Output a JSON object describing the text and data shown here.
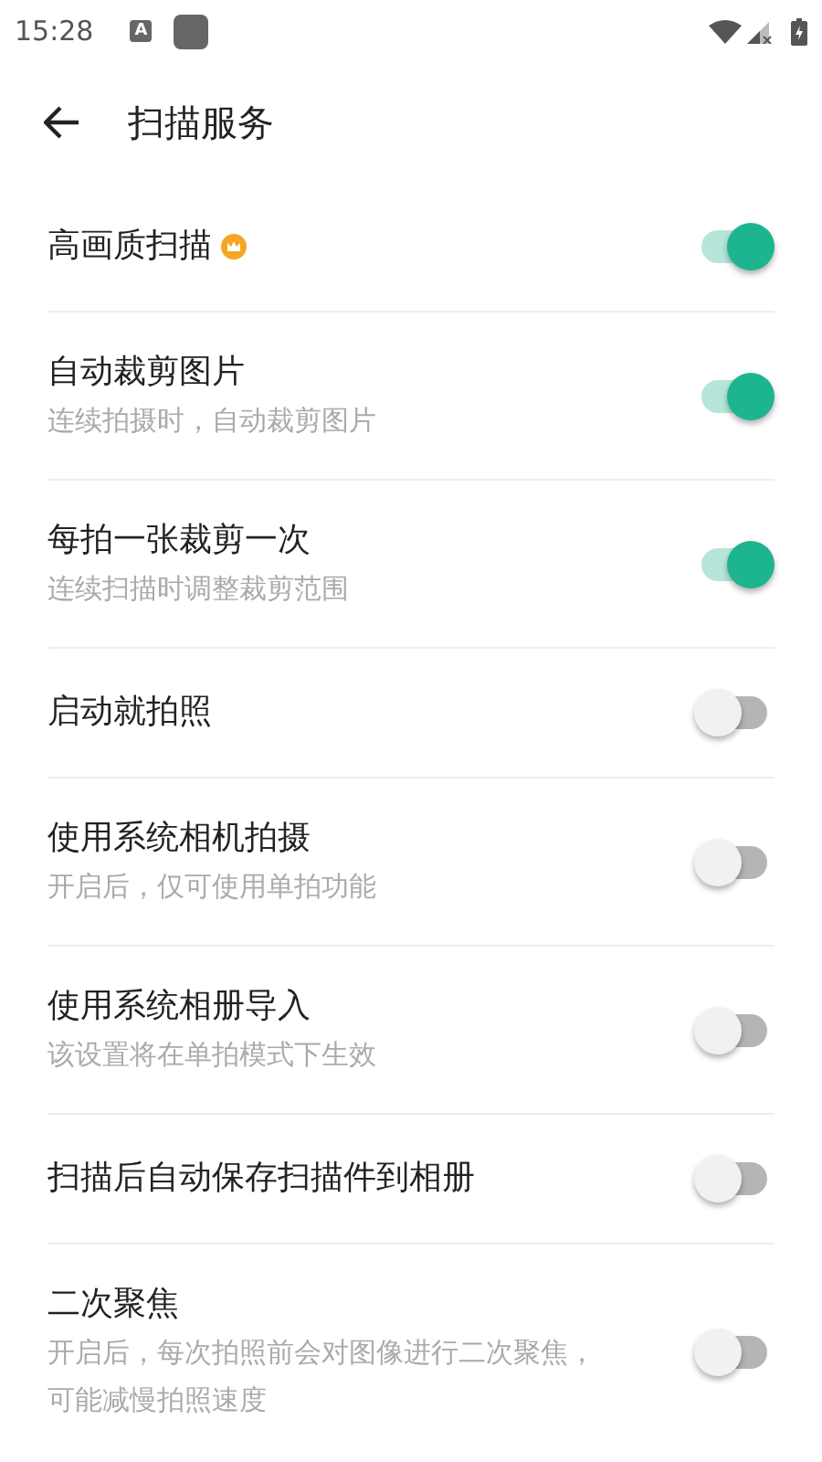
{
  "status_bar": {
    "time": "15:28",
    "notification_letter": "A"
  },
  "app_bar": {
    "title": "扫描服务"
  },
  "settings": [
    {
      "title": "高画质扫描",
      "premium": true,
      "on": true
    },
    {
      "title": "自动裁剪图片",
      "subtitle": "连续拍摄时，自动裁剪图片",
      "premium": false,
      "on": true
    },
    {
      "title": "每拍一张裁剪一次",
      "subtitle": "连续扫描时调整裁剪范围",
      "premium": false,
      "on": true
    },
    {
      "title": "启动就拍照",
      "premium": false,
      "on": false
    },
    {
      "title": "使用系统相机拍摄",
      "subtitle": "开启后，仅可使用单拍功能",
      "premium": false,
      "on": false
    },
    {
      "title": "使用系统相册导入",
      "subtitle": "该设置将在单拍模式下生效",
      "premium": false,
      "on": false
    },
    {
      "title": "扫描后自动保存扫描件到相册",
      "premium": false,
      "on": false
    },
    {
      "title": "二次聚焦",
      "subtitle": "开启后，每次拍照前会对图像进行二次聚焦，可能减慢拍照速度",
      "premium": false,
      "on": false
    }
  ]
}
